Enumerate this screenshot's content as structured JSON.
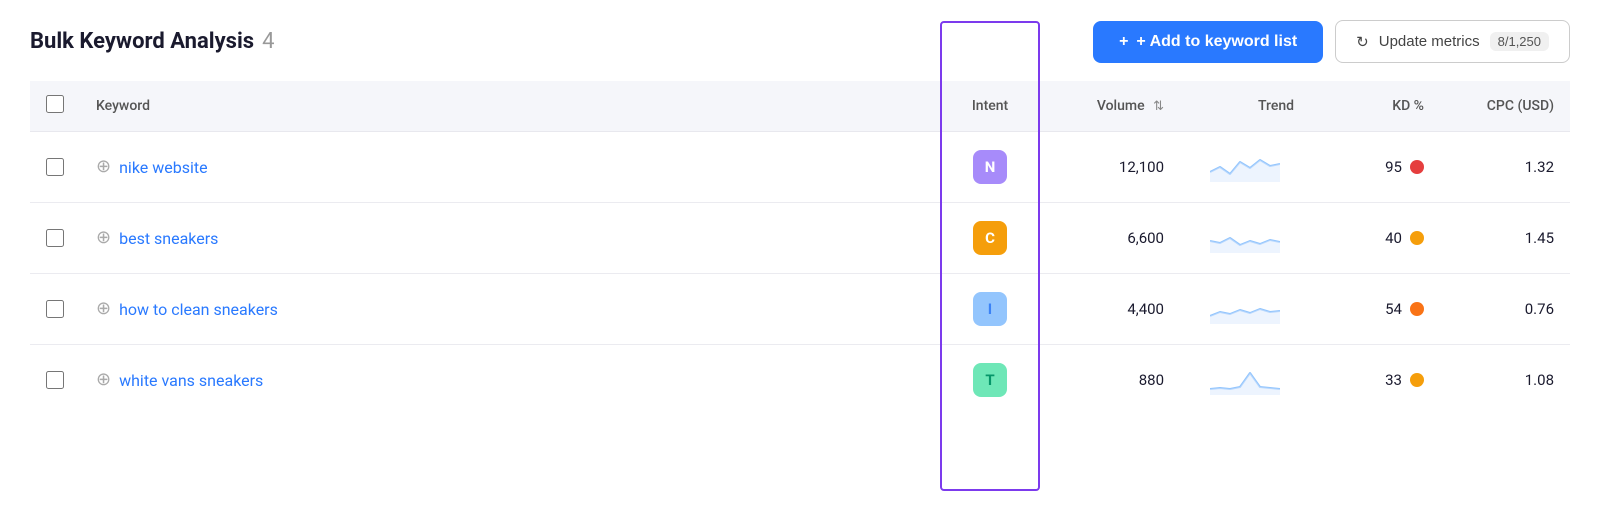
{
  "header": {
    "title": "Bulk Keyword Analysis",
    "count": "4",
    "add_button_label": "+ Add to keyword list",
    "update_button_label": "Update metrics",
    "update_badge": "8/1,250"
  },
  "table": {
    "columns": {
      "keyword": "Keyword",
      "intent": "Intent",
      "volume": "Volume",
      "trend": "Trend",
      "kd": "KD %",
      "cpc": "CPC (USD)"
    },
    "rows": [
      {
        "id": 1,
        "keyword": "nike website",
        "intent_label": "N",
        "intent_class": "intent-n",
        "volume": "12,100",
        "kd": "95",
        "kd_class": "kd-red",
        "cpc": "1.32",
        "trend_type": "high-wave"
      },
      {
        "id": 2,
        "keyword": "best sneakers",
        "intent_label": "C",
        "intent_class": "intent-c",
        "volume": "6,600",
        "kd": "40",
        "kd_class": "kd-orange",
        "cpc": "1.45",
        "trend_type": "mid-flat"
      },
      {
        "id": 3,
        "keyword": "how to clean sneakers",
        "intent_label": "I",
        "intent_class": "intent-i",
        "volume": "4,400",
        "kd": "54",
        "kd_class": "kd-orange-light",
        "cpc": "0.76",
        "trend_type": "mid-wave"
      },
      {
        "id": 4,
        "keyword": "white vans sneakers",
        "intent_label": "T",
        "intent_class": "intent-t",
        "volume": "880",
        "kd": "33",
        "kd_class": "kd-orange",
        "cpc": "1.08",
        "trend_type": "spike"
      }
    ]
  },
  "icons": {
    "plus": "+",
    "refresh": "↻",
    "add_row": "⊕",
    "sort": "⇅"
  }
}
